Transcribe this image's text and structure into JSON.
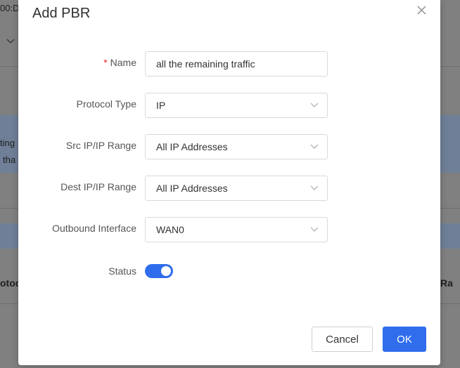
{
  "background": {
    "top_left_text": "00:D",
    "line_a": "ting",
    "line_b": "tha",
    "col_left": "otoc",
    "col_right": "rt Ra"
  },
  "modal": {
    "title": "Add PBR",
    "fields": {
      "name": {
        "label": "Name",
        "required_mark": "*",
        "value": "all the remaining traffic"
      },
      "protocol_type": {
        "label": "Protocol Type",
        "value": "IP"
      },
      "src_ip": {
        "label": "Src IP/IP Range",
        "value": "All IP Addresses"
      },
      "dest_ip": {
        "label": "Dest IP/IP Range",
        "value": "All IP Addresses"
      },
      "outbound_interface": {
        "label": "Outbound Interface",
        "value": "WAN0"
      },
      "status": {
        "label": "Status",
        "enabled": true
      }
    },
    "buttons": {
      "cancel": "Cancel",
      "ok": "OK"
    }
  },
  "colors": {
    "accent": "#2f6ded",
    "required": "#f5222d",
    "overlay": "#808080"
  }
}
